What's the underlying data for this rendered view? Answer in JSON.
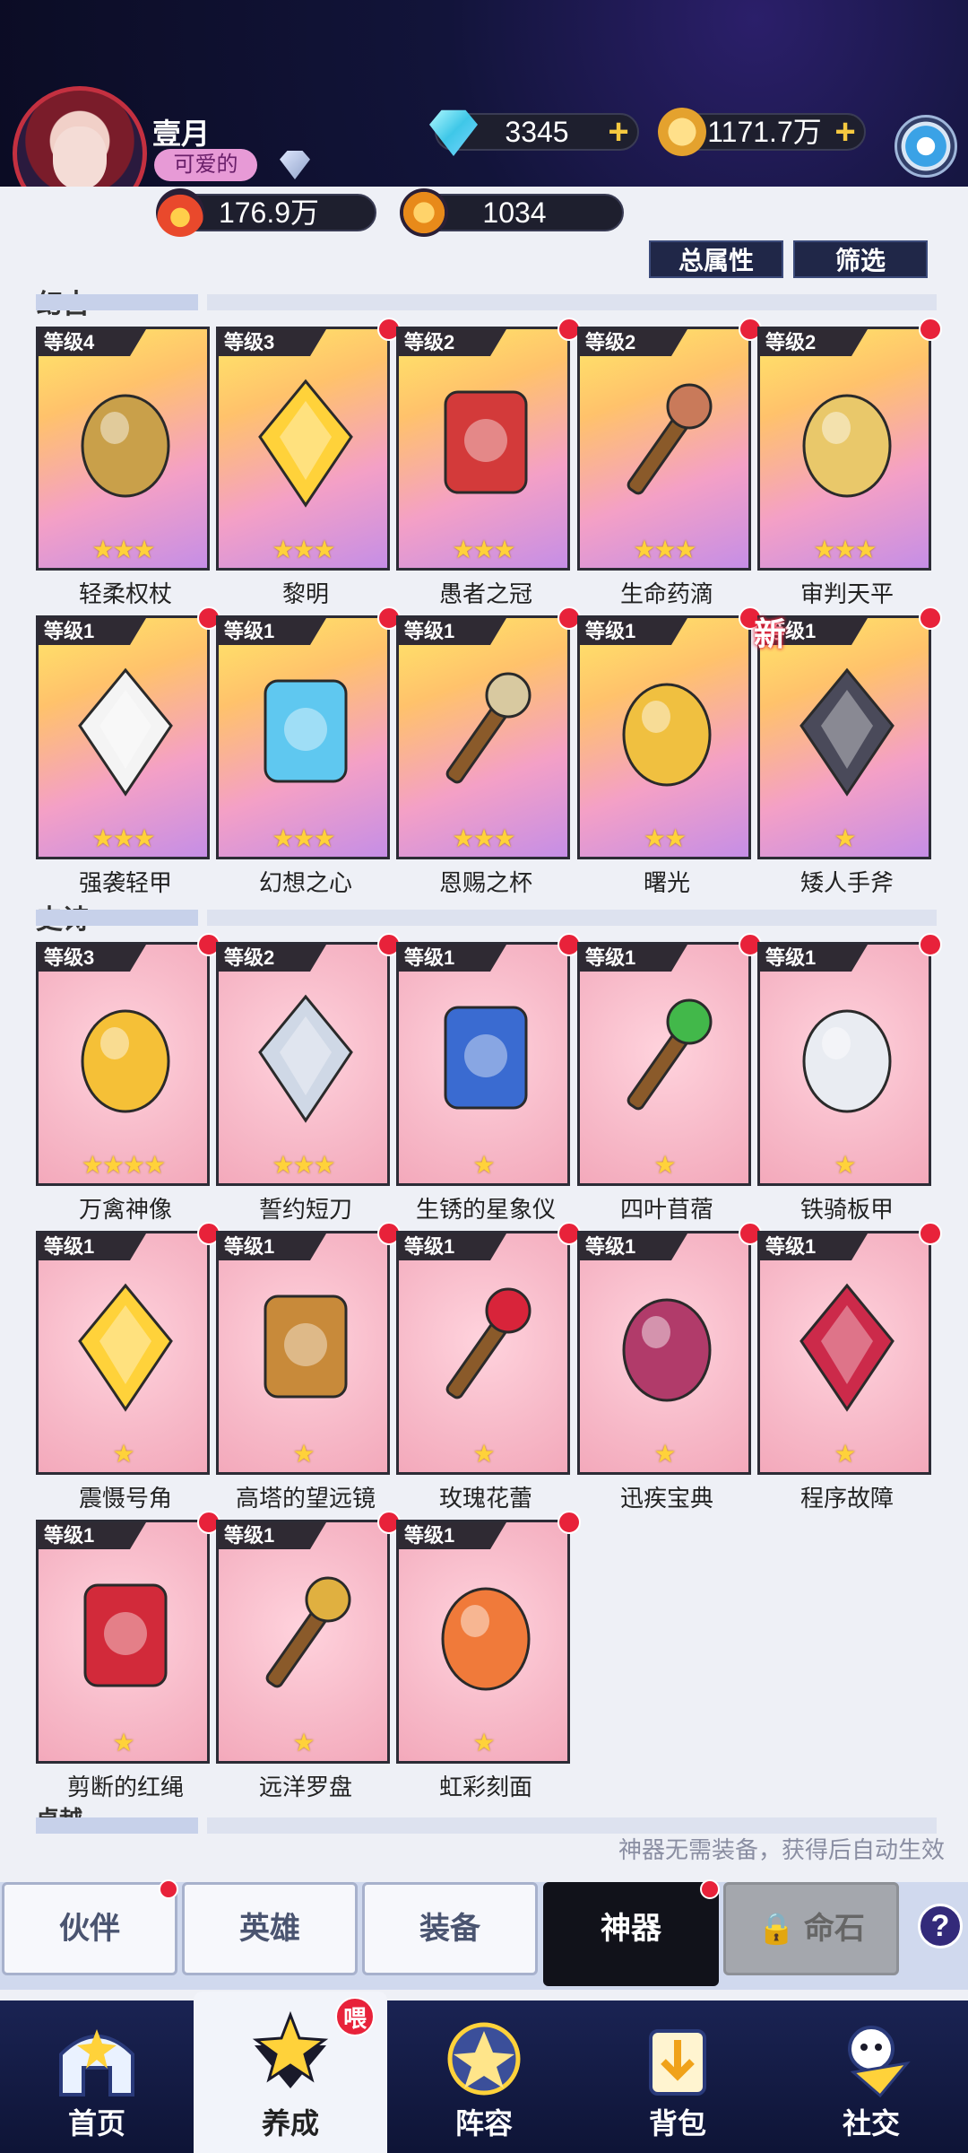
{
  "header": {
    "player_name": "壹月",
    "title_badge": "可爱的",
    "diamonds": "3345",
    "gold": "1171.7万",
    "power": "176.9万",
    "stars": "1034"
  },
  "toolbar": {
    "total_attr_label": "总属性",
    "filter_label": "筛选"
  },
  "sections": {
    "legendary": "幻古",
    "epic": "史诗",
    "rare": "卓越"
  },
  "legendary_items": [
    {
      "level": "等级4",
      "name": "轻柔权杖",
      "stars": "★★★",
      "badge": false,
      "new": false
    },
    {
      "level": "等级3",
      "name": "黎明",
      "stars": "★★★",
      "badge": true,
      "new": false
    },
    {
      "level": "等级2",
      "name": "愚者之冠",
      "stars": "★★★",
      "badge": true,
      "new": false
    },
    {
      "level": "等级2",
      "name": "生命药滴",
      "stars": "★★★",
      "badge": true,
      "new": false
    },
    {
      "level": "等级2",
      "name": "审判天平",
      "stars": "★★★",
      "badge": true,
      "new": false
    },
    {
      "level": "等级1",
      "name": "强袭轻甲",
      "stars": "★★★",
      "badge": true,
      "new": false
    },
    {
      "level": "等级1",
      "name": "幻想之心",
      "stars": "★★★",
      "badge": true,
      "new": false
    },
    {
      "level": "等级1",
      "name": "恩赐之杯",
      "stars": "★★★",
      "badge": true,
      "new": false
    },
    {
      "level": "等级1",
      "name": "曙光",
      "stars": "★★",
      "badge": true,
      "new": false
    },
    {
      "level": "等级1",
      "name": "矮人手斧",
      "stars": "★",
      "badge": true,
      "new": true
    }
  ],
  "new_label": "新",
  "epic_items": [
    {
      "level": "等级3",
      "name": "万禽神像",
      "stars": "★★★★"
    },
    {
      "level": "等级2",
      "name": "誓约短刀",
      "stars": "★★★"
    },
    {
      "level": "等级1",
      "name": "生锈的星象仪",
      "stars": "★"
    },
    {
      "level": "等级1",
      "name": "四叶苜蓿",
      "stars": "★"
    },
    {
      "level": "等级1",
      "name": "铁骑板甲",
      "stars": "★"
    },
    {
      "level": "等级1",
      "name": "震慑号角",
      "stars": "★"
    },
    {
      "level": "等级1",
      "name": "高塔的望远镜",
      "stars": "★"
    },
    {
      "level": "等级1",
      "name": "玫瑰花蕾",
      "stars": "★"
    },
    {
      "level": "等级1",
      "name": "迅疾宝典",
      "stars": "★"
    },
    {
      "level": "等级1",
      "name": "程序故障",
      "stars": "★"
    },
    {
      "level": "等级1",
      "name": "剪断的红绳",
      "stars": "★"
    },
    {
      "level": "等级1",
      "name": "远洋罗盘",
      "stars": "★"
    },
    {
      "level": "等级1",
      "name": "虹彩刻面",
      "stars": "★"
    }
  ],
  "hint": "神器无需装备，获得后自动生效",
  "tabs": {
    "partner": "伙伴",
    "hero": "英雄",
    "equip": "装备",
    "artifact": "神器",
    "lifestone": "命石",
    "help": "?"
  },
  "nav": {
    "home": "首页",
    "train": "养成",
    "train_badge": "喂",
    "lineup": "阵容",
    "bag": "背包",
    "social": "社交"
  }
}
